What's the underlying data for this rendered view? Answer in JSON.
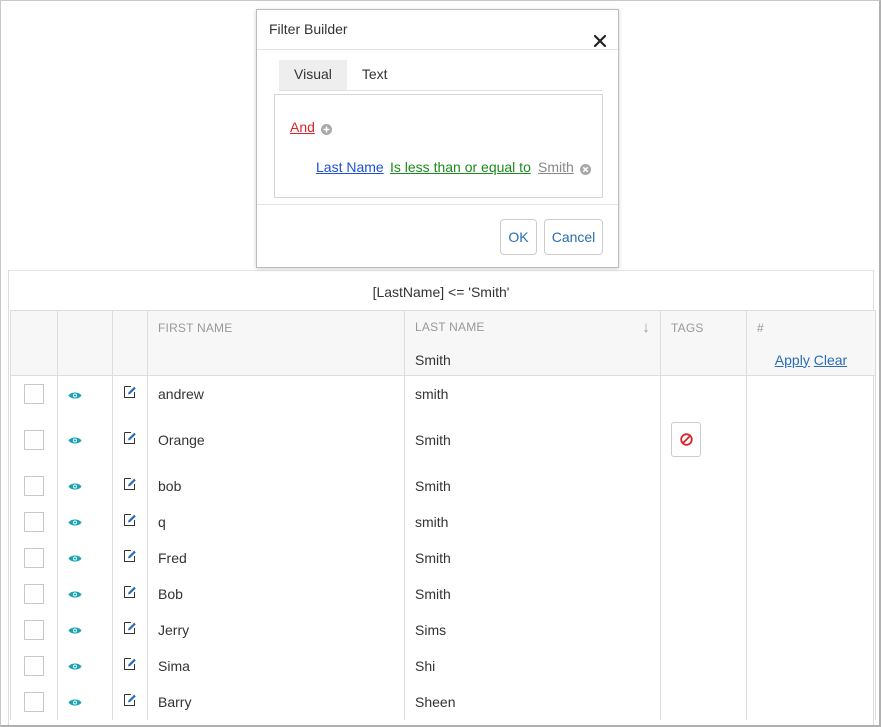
{
  "dialog": {
    "title": "Filter Builder",
    "tabs": [
      {
        "label": "Visual",
        "active": true
      },
      {
        "label": "Text",
        "active": false
      }
    ],
    "builder": {
      "group_op": "And",
      "condition": {
        "field": "Last Name",
        "operator": "Is less than or equal to",
        "value": "Smith"
      }
    },
    "ok_label": "OK",
    "cancel_label": "Cancel"
  },
  "grid": {
    "filter_expression": "[LastName] <= 'Smith'",
    "columns": [
      "FIRST NAME",
      "LAST NAME",
      "TAGS",
      "#"
    ],
    "sort_indicator": "↓",
    "filter_row": {
      "last_name": "Smith",
      "apply_label": "Apply",
      "clear_label": "Clear"
    },
    "rows": [
      {
        "first": "andrew",
        "last": "smith"
      },
      {
        "first": "Orange",
        "last": "Smith",
        "has_tag_button": true
      },
      {
        "first": "bob",
        "last": "Smith"
      },
      {
        "first": "q",
        "last": "smith"
      },
      {
        "first": "Fred",
        "last": "Smith"
      },
      {
        "first": "Bob",
        "last": "Smith"
      },
      {
        "first": "Jerry",
        "last": "Sims"
      },
      {
        "first": "Sima",
        "last": "Shi"
      },
      {
        "first": "Barry",
        "last": "Sheen"
      }
    ]
  },
  "colors": {
    "accent": "#2a6db5",
    "eye_icon": "#1ba3b5",
    "edit_icon": "#2a6db5",
    "group_op": "#d9262a",
    "field": "#1f4fdb",
    "operator": "#1c8a1c",
    "ban_icon": "#d9262a"
  },
  "icons": [
    "close-icon",
    "add-circle-icon",
    "remove-circle-icon",
    "eye-icon",
    "edit-icon",
    "ban-icon",
    "sort-down-icon"
  ]
}
